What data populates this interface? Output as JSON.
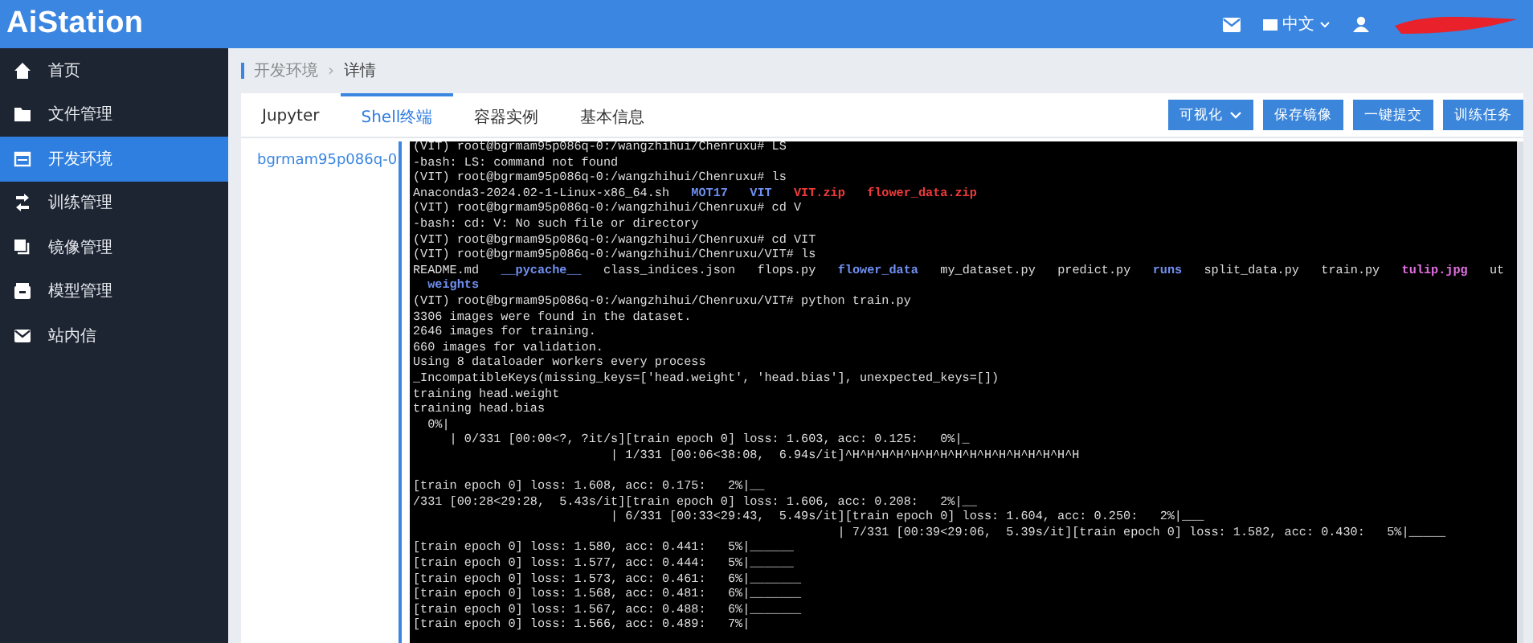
{
  "header": {
    "logo": "AiStation",
    "language": "中文"
  },
  "sidebar": {
    "items": [
      {
        "label": "首页",
        "selected": false
      },
      {
        "label": "文件管理",
        "selected": false
      },
      {
        "label": "开发环境",
        "selected": true
      },
      {
        "label": "训练管理",
        "selected": false
      },
      {
        "label": "镜像管理",
        "selected": false
      },
      {
        "label": "模型管理",
        "selected": false
      },
      {
        "label": "站内信",
        "selected": false
      }
    ]
  },
  "breadcrumb": [
    "开发环境",
    "›",
    "详情"
  ],
  "tabs": [
    {
      "label": "Jupyter",
      "selected": false
    },
    {
      "label": "Shell终端",
      "selected": true
    },
    {
      "label": "容器实例",
      "selected": false
    },
    {
      "label": "基本信息",
      "selected": false
    }
  ],
  "actions": [
    {
      "label": "可视化",
      "dropdown": true
    },
    {
      "label": "保存镜像",
      "dropdown": false
    },
    {
      "label": "一键提交",
      "dropdown": false
    },
    {
      "label": "训练任务",
      "dropdown": false
    }
  ],
  "pods": [
    {
      "label": "bgrmam95p086q-0",
      "selected": true
    }
  ],
  "terminal": {
    "lines": [
      {
        "segments": [
          {
            "kind": "plain",
            "text": "(VIT) root@bgrmam95p086q-0:/wangzhihui/Chenruxu# LS"
          }
        ]
      },
      {
        "segments": [
          {
            "kind": "plain",
            "text": "-bash: LS: command not found"
          }
        ]
      },
      {
        "segments": [
          {
            "kind": "plain",
            "text": "(VIT) root@bgrmam95p086q-0:/wangzhihui/Chenruxu# ls"
          }
        ]
      },
      {
        "segments": [
          {
            "kind": "plain",
            "text": "Anaconda3-2024.02-1-Linux-x86_64.sh"
          },
          {
            "kind": "dir",
            "text": "MOT17"
          },
          {
            "kind": "dir",
            "text": "VIT"
          },
          {
            "kind": "archive",
            "text": "VIT.zip"
          },
          {
            "kind": "archive",
            "text": "flower_data.zip"
          }
        ]
      },
      {
        "segments": [
          {
            "kind": "plain",
            "text": "(VIT) root@bgrmam95p086q-0:/wangzhihui/Chenruxu# cd V"
          }
        ]
      },
      {
        "segments": [
          {
            "kind": "plain",
            "text": "-bash: cd: V: No such file or directory"
          }
        ]
      },
      {
        "segments": [
          {
            "kind": "plain",
            "text": "(VIT) root@bgrmam95p086q-0:/wangzhihui/Chenruxu# cd VIT"
          }
        ]
      },
      {
        "segments": [
          {
            "kind": "plain",
            "text": "(VIT) root@bgrmam95p086q-0:/wangzhihui/Chenruxu/VIT# ls"
          }
        ]
      },
      {
        "segments": [
          {
            "kind": "plain",
            "text": "README.md"
          },
          {
            "kind": "dir",
            "text": "__pycache__"
          },
          {
            "kind": "plain",
            "text": "class_indices.json"
          },
          {
            "kind": "plain",
            "text": "flops.py"
          },
          {
            "kind": "dir",
            "text": "flower_data"
          },
          {
            "kind": "plain",
            "text": "my_dataset.py"
          },
          {
            "kind": "plain",
            "text": "predict.py"
          },
          {
            "kind": "dir",
            "text": "runs"
          },
          {
            "kind": "plain",
            "text": "split_data.py"
          },
          {
            "kind": "plain",
            "text": "train.py"
          },
          {
            "kind": "image",
            "text": "tulip.jpg"
          },
          {
            "kind": "plain",
            "text": "ut"
          }
        ]
      },
      {
        "wrapped": true,
        "segments": [
          {
            "kind": "dir",
            "text": "weights"
          }
        ]
      },
      {
        "segments": [
          {
            "kind": "plain",
            "text": "(VIT) root@bgrmam95p086q-0:/wangzhihui/Chenruxu/VIT# python train.py"
          }
        ]
      },
      {
        "segments": [
          {
            "kind": "plain",
            "text": "3306 images were found in the dataset."
          }
        ]
      },
      {
        "segments": [
          {
            "kind": "plain",
            "text": "2646 images for training."
          }
        ]
      },
      {
        "segments": [
          {
            "kind": "plain",
            "text": "660 images for validation."
          }
        ]
      },
      {
        "segments": [
          {
            "kind": "plain",
            "text": "Using 8 dataloader workers every process"
          }
        ]
      },
      {
        "segments": [
          {
            "kind": "plain",
            "text": "_IncompatibleKeys(missing_keys=['head.weight', 'head.bias'], unexpected_keys=[])"
          }
        ]
      },
      {
        "segments": [
          {
            "kind": "plain",
            "text": "training head.weight"
          }
        ]
      },
      {
        "segments": [
          {
            "kind": "plain",
            "text": "training head.bias"
          }
        ]
      },
      {
        "segments": [
          {
            "kind": "plain",
            "text": "  0%|"
          }
        ]
      },
      {
        "segments": [
          {
            "kind": "plain",
            "text": "     | 0/331 [00:00<?, ?it/s][train epoch 0] loss: 1.603, acc: 0.125:   0%|_"
          }
        ]
      },
      {
        "segments": [
          {
            "kind": "plain",
            "text": "                           | 1/331 [00:06<38:08,  6.94s/it]^H^H^H^H^H^H^H^H^H^H^H^H^H^H^H^H"
          }
        ]
      },
      {
        "spaced": true,
        "segments": [
          {
            "kind": "plain",
            "text": "[train epoch 0] loss: 1.608, acc: 0.175:   2%|__"
          }
        ]
      },
      {
        "segments": [
          {
            "kind": "plain",
            "text": "/331 [00:28<29:28,  5.43s/it][train epoch 0] loss: 1.606, acc: 0.208:   2%|__"
          }
        ]
      },
      {
        "segments": [
          {
            "kind": "plain",
            "text": "                           | 6/331 [00:33<29:43,  5.49s/it][train epoch 0] loss: 1.604, acc: 0.250:   2%|___"
          }
        ]
      },
      {
        "segments": [
          {
            "kind": "plain",
            "text": "                                                          | 7/331 [00:39<29:06,  5.39s/it][train epoch 0] loss: 1.582, acc: 0.430:   5%|_____"
          }
        ]
      },
      {
        "segments": [
          {
            "kind": "plain",
            "text": "[train epoch 0] loss: 1.580, acc: 0.441:   5%|______"
          }
        ]
      },
      {
        "segments": [
          {
            "kind": "plain",
            "text": "[train epoch 0] loss: 1.577, acc: 0.444:   5%|______"
          }
        ]
      },
      {
        "segments": [
          {
            "kind": "plain",
            "text": "[train epoch 0] loss: 1.573, acc: 0.461:   6%|_______"
          }
        ]
      },
      {
        "segments": [
          {
            "kind": "plain",
            "text": "[train epoch 0] loss: 1.568, acc: 0.481:   6%|_______"
          }
        ]
      },
      {
        "segments": [
          {
            "kind": "plain",
            "text": "[train epoch 0] loss: 1.567, acc: 0.488:   6%|_______"
          }
        ]
      },
      {
        "segments": [
          {
            "kind": "plain",
            "text": "[train epoch 0] loss: 1.566, acc: 0.489:   7%|"
          }
        ]
      }
    ]
  }
}
